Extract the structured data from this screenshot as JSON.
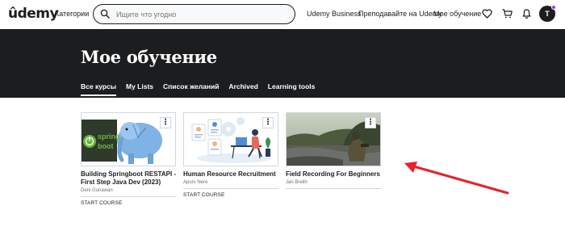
{
  "header": {
    "logo_text": "ûdemy",
    "categories_label": "Категории",
    "search_placeholder": "Ищите что угодно",
    "links": [
      "Udemy Business",
      "Преподавайте на Udemy",
      "Мое обучение"
    ],
    "icons": [
      "heart-icon",
      "cart-icon",
      "bell-icon"
    ],
    "avatar_initial": "T",
    "accent_color": "#a435f0"
  },
  "banner": {
    "title": "Мое обучение",
    "background": "#1c1d1f",
    "tabs": [
      {
        "label": "Все курсы",
        "active": true
      },
      {
        "label": "My Lists",
        "active": false
      },
      {
        "label": "Список желаний",
        "active": false
      },
      {
        "label": "Archived",
        "active": false
      },
      {
        "label": "Learning tools",
        "active": false
      }
    ]
  },
  "courses": [
    {
      "title": "Building Springboot RESTAPI - First Step Java Dev (2023)",
      "author": "Deni Gunawan",
      "action": "START COURSE",
      "thumb_text": [
        "spring",
        "boot"
      ]
    },
    {
      "title": "Human Resource Recruitment",
      "author": "Apurv Nere",
      "action": "START COURSE"
    },
    {
      "title": "Field Recording For Beginners",
      "author": "Jan Brelih",
      "action": ""
    }
  ],
  "more_label": "⋮"
}
